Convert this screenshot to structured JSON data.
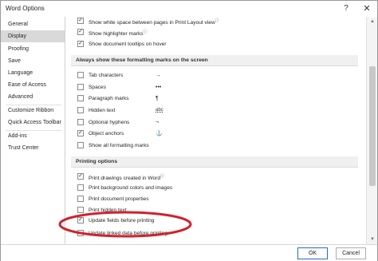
{
  "window": {
    "title": "Word Options",
    "help_icon": "?",
    "close_icon": "✕"
  },
  "sidebar": {
    "items": [
      {
        "label": "General"
      },
      {
        "label": "Display"
      },
      {
        "label": "Proofing"
      },
      {
        "label": "Save"
      },
      {
        "label": "Language"
      },
      {
        "label": "Ease of Access"
      },
      {
        "label": "Advanced"
      },
      {
        "label": "Customize Ribbon"
      },
      {
        "label": "Quick Access Toolbar"
      },
      {
        "label": "Add-ins"
      },
      {
        "label": "Trust Center"
      }
    ],
    "selected": "Display"
  },
  "page_display": {
    "items": [
      {
        "label": "Show white space between pages in Print Layout view",
        "info": "ⓘ",
        "checked": true,
        "check": "✓"
      },
      {
        "label": "Show highlighter marks",
        "info": "ⓘ",
        "checked": true,
        "check": "✓"
      },
      {
        "label": "Show document tooltips on hover",
        "checked": true,
        "check": "✓"
      }
    ]
  },
  "formatting_marks": {
    "header": "Always show these formatting marks on the screen",
    "items": [
      {
        "label": "Tab characters",
        "mark": "→",
        "checked": false
      },
      {
        "label": "Spaces",
        "mark": "•••",
        "checked": false
      },
      {
        "label": "Paragraph marks",
        "mark": "¶",
        "checked": false
      },
      {
        "label": "Hidden text",
        "mark": "abc",
        "checked": false
      },
      {
        "label": "Optional hyphens",
        "mark": "¬",
        "checked": false
      },
      {
        "label": "Object anchors",
        "mark": "⚓",
        "checked": true,
        "check": "✓"
      },
      {
        "label": "Show all formatting marks",
        "checked": false
      }
    ]
  },
  "printing_options": {
    "header": "Printing options",
    "items": [
      {
        "label": "Print drawings created in Word",
        "info": "ⓘ",
        "checked": true,
        "check": "✓"
      },
      {
        "label": "Print background colors and images",
        "checked": false
      },
      {
        "label": "Print document properties",
        "checked": false
      },
      {
        "label": "Print hidden text",
        "checked": false
      },
      {
        "label": "Update fields before printing",
        "checked": true,
        "check": "✓"
      },
      {
        "label": "Update linked data before printing",
        "checked": false
      }
    ]
  },
  "footer": {
    "ok_label": "OK",
    "cancel_label": "Cancel"
  },
  "scrollbar": {
    "up_icon": "▲",
    "down_icon": "▼"
  },
  "colors": {
    "highlight": "#d0222e",
    "selected_nav": "#d9d9d9",
    "section_header": "#f0f0f0"
  }
}
